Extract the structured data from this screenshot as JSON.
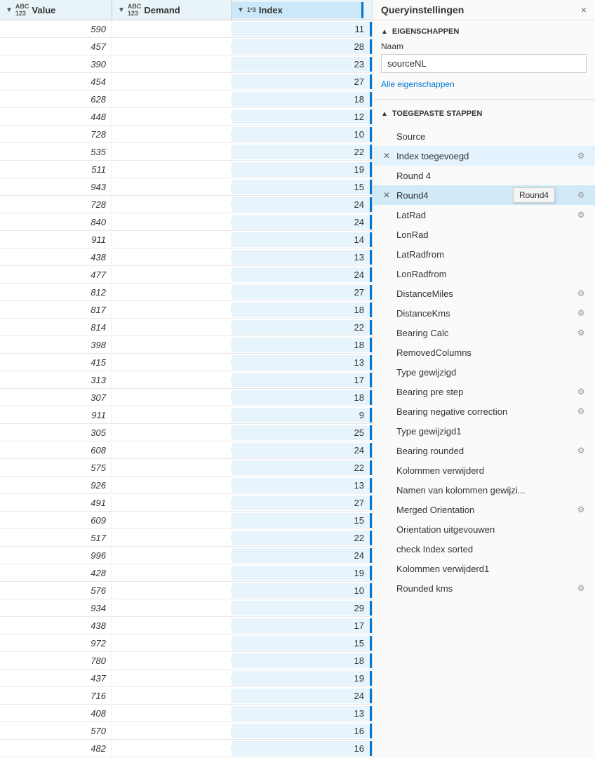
{
  "panel": {
    "title": "Queryinstellingen",
    "close_icon": "×",
    "sections": {
      "eigenschappen": {
        "label": "EIGENSCHAPPEN",
        "naam_label": "Naam",
        "naam_value": "sourceNL",
        "alle_eigenschappen_link": "Alle eigenschappen"
      },
      "toegepaste_stappen": {
        "label": "TOEGEPASTE STAPPEN",
        "steps": [
          {
            "name": "Source",
            "has_delete": false,
            "has_gear": false,
            "highlighted": false
          },
          {
            "name": "Index toegevoegd",
            "has_delete": true,
            "has_gear": true,
            "highlighted": true
          },
          {
            "name": "Round 4",
            "has_delete": false,
            "has_gear": false,
            "highlighted": false
          },
          {
            "name": "Round4",
            "has_delete": true,
            "has_gear": true,
            "highlighted": true,
            "tooltip": "Round4",
            "is_active": true
          },
          {
            "name": "LatRad",
            "has_delete": false,
            "has_gear": true,
            "highlighted": false
          },
          {
            "name": "LonRad",
            "has_delete": false,
            "has_gear": false,
            "highlighted": false
          },
          {
            "name": "LatRadfrom",
            "has_delete": false,
            "has_gear": false,
            "highlighted": false
          },
          {
            "name": "LonRadfrom",
            "has_delete": false,
            "has_gear": false,
            "highlighted": false
          },
          {
            "name": "DistanceMiles",
            "has_delete": false,
            "has_gear": true,
            "highlighted": false
          },
          {
            "name": "DistanceKms",
            "has_delete": false,
            "has_gear": true,
            "highlighted": false
          },
          {
            "name": "Bearing Calc",
            "has_delete": false,
            "has_gear": true,
            "highlighted": false
          },
          {
            "name": "RemovedColumns",
            "has_delete": false,
            "has_gear": false,
            "highlighted": false
          },
          {
            "name": "Type gewijzigd",
            "has_delete": false,
            "has_gear": false,
            "highlighted": false
          },
          {
            "name": "Bearing pre step",
            "has_delete": false,
            "has_gear": true,
            "highlighted": false
          },
          {
            "name": "Bearing negative correction",
            "has_delete": false,
            "has_gear": true,
            "highlighted": false
          },
          {
            "name": "Type gewijzigd1",
            "has_delete": false,
            "has_gear": false,
            "highlighted": false
          },
          {
            "name": "Bearing rounded",
            "has_delete": false,
            "has_gear": true,
            "highlighted": false
          },
          {
            "name": "Kolommen verwijderd",
            "has_delete": false,
            "has_gear": false,
            "highlighted": false
          },
          {
            "name": "Namen van kolommen gewijzi...",
            "has_delete": false,
            "has_gear": false,
            "highlighted": false
          },
          {
            "name": "Merged Orientation",
            "has_delete": false,
            "has_gear": true,
            "highlighted": false
          },
          {
            "name": "Orientation uitgevouwen",
            "has_delete": false,
            "has_gear": false,
            "highlighted": false
          },
          {
            "name": "check Index sorted",
            "has_delete": false,
            "has_gear": false,
            "highlighted": false
          },
          {
            "name": "Kolommen verwijderd1",
            "has_delete": false,
            "has_gear": false,
            "highlighted": false
          },
          {
            "name": "Rounded kms",
            "has_delete": false,
            "has_gear": true,
            "highlighted": false
          }
        ]
      }
    }
  },
  "table": {
    "columns": {
      "value": "Value",
      "demand": "Demand",
      "index": "Index"
    },
    "value_icon": "▼",
    "demand_icon": "▼",
    "index_icon": "▼",
    "rows": [
      {
        "value": "590",
        "demand": "",
        "index": "11"
      },
      {
        "value": "457",
        "demand": "",
        "index": "28"
      },
      {
        "value": "390",
        "demand": "",
        "index": "23"
      },
      {
        "value": "454",
        "demand": "",
        "index": "27"
      },
      {
        "value": "628",
        "demand": "",
        "index": "18"
      },
      {
        "value": "448",
        "demand": "",
        "index": "12"
      },
      {
        "value": "728",
        "demand": "",
        "index": "10"
      },
      {
        "value": "535",
        "demand": "",
        "index": "22"
      },
      {
        "value": "511",
        "demand": "",
        "index": "19"
      },
      {
        "value": "943",
        "demand": "",
        "index": "15"
      },
      {
        "value": "728",
        "demand": "",
        "index": "24"
      },
      {
        "value": "840",
        "demand": "",
        "index": "24"
      },
      {
        "value": "911",
        "demand": "",
        "index": "14"
      },
      {
        "value": "438",
        "demand": "",
        "index": "13"
      },
      {
        "value": "477",
        "demand": "",
        "index": "24"
      },
      {
        "value": "812",
        "demand": "",
        "index": "27"
      },
      {
        "value": "817",
        "demand": "",
        "index": "18"
      },
      {
        "value": "814",
        "demand": "",
        "index": "22"
      },
      {
        "value": "398",
        "demand": "",
        "index": "18"
      },
      {
        "value": "415",
        "demand": "",
        "index": "13"
      },
      {
        "value": "313",
        "demand": "",
        "index": "17"
      },
      {
        "value": "307",
        "demand": "",
        "index": "18"
      },
      {
        "value": "911",
        "demand": "",
        "index": "9"
      },
      {
        "value": "305",
        "demand": "",
        "index": "25"
      },
      {
        "value": "608",
        "demand": "",
        "index": "24"
      },
      {
        "value": "575",
        "demand": "",
        "index": "22"
      },
      {
        "value": "926",
        "demand": "",
        "index": "13"
      },
      {
        "value": "491",
        "demand": "",
        "index": "27"
      },
      {
        "value": "609",
        "demand": "",
        "index": "15"
      },
      {
        "value": "517",
        "demand": "",
        "index": "22"
      },
      {
        "value": "996",
        "demand": "",
        "index": "24"
      },
      {
        "value": "428",
        "demand": "",
        "index": "19"
      },
      {
        "value": "576",
        "demand": "",
        "index": "10"
      },
      {
        "value": "934",
        "demand": "",
        "index": "29"
      },
      {
        "value": "438",
        "demand": "",
        "index": "17"
      },
      {
        "value": "972",
        "demand": "",
        "index": "15"
      },
      {
        "value": "780",
        "demand": "",
        "index": "18"
      },
      {
        "value": "437",
        "demand": "",
        "index": "19"
      },
      {
        "value": "716",
        "demand": "",
        "index": "24"
      },
      {
        "value": "408",
        "demand": "",
        "index": "13"
      },
      {
        "value": "570",
        "demand": "",
        "index": "16"
      },
      {
        "value": "482",
        "demand": "",
        "index": "16"
      }
    ]
  },
  "colors": {
    "accent": "#0078d4",
    "highlight_blue": "#cce8f8",
    "row_highlight": "#e3f2fd"
  }
}
